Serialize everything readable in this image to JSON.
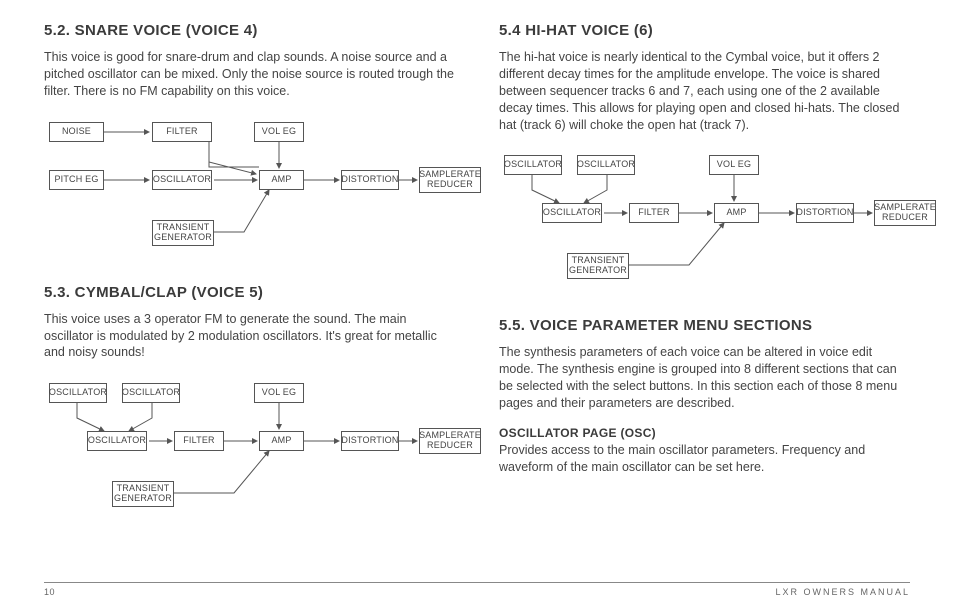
{
  "left": {
    "section1": {
      "heading": "5.2. SNARE VOICE (VOICE 4)",
      "body": "This voice is good for snare-drum and clap sounds. A noise source and a pitched oscillator can be mixed. Only the noise source is routed trough the filter. There is no FM capability on this voice.",
      "boxes": {
        "noise": "NOISE",
        "filter": "FILTER",
        "voleg": "VOL EG",
        "pitcheg": "PITCH EG",
        "osc": "OSCILLATOR",
        "amp": "AMP",
        "dist": "DISTORTION",
        "sr": "SAMPLERATE REDUCER",
        "trans": "TRANSIENT GENERATOR"
      }
    },
    "section2": {
      "heading": "5.3. CYMBAL/CLAP (VOICE 5)",
      "body": "This voice uses a 3 operator FM to generate the sound. The main oscillator is modulated by 2 modulation oscillators. It's great for metallic and noisy sounds!",
      "boxes": {
        "osc1": "OSCILLATOR",
        "osc2": "OSCILLATOR",
        "voleg": "VOL EG",
        "osc": "OSCILLATOR",
        "filter": "FILTER",
        "amp": "AMP",
        "dist": "DISTORTION",
        "sr": "SAMPLERATE REDUCER",
        "trans": "TRANSIENT GENERATOR"
      }
    }
  },
  "right": {
    "section1": {
      "heading": "5.4 HI-HAT VOICE (6)",
      "body": "The hi-hat voice is nearly identical to the Cymbal voice, but it offers 2 different decay times for the amplitude envelope. The voice is shared between sequencer tracks 6 and 7, each using one of the 2 available decay times. This allows for playing open and closed hi-hats. The closed hat (track 6) will choke the open hat (track 7).",
      "boxes": {
        "osc1": "OSCILLATOR",
        "osc2": "OSCILLATOR",
        "voleg": "VOL EG",
        "osc": "OSCILLATOR",
        "filter": "FILTER",
        "amp": "AMP",
        "dist": "DISTORTION",
        "sr": "SAMPLERATE REDUCER",
        "trans": "TRANSIENT GENERATOR"
      }
    },
    "section2": {
      "heading": "5.5. VOICE PARAMETER MENU SECTIONS",
      "body": "The synthesis parameters of each voice can be altered in voice edit mode. The synthesis engine is grouped into 8 different sections that can be selected with the select buttons. In this section each of those 8 menu pages and their parameters are described.",
      "sub_heading": "OSCILLATOR PAGE (OSC)",
      "sub_body": "Provides access to the main oscillator parameters. Frequency and waveform of the main oscillator can be set here."
    }
  },
  "footer": {
    "page": "10",
    "title": "LXR OWNERS MANUAL"
  }
}
